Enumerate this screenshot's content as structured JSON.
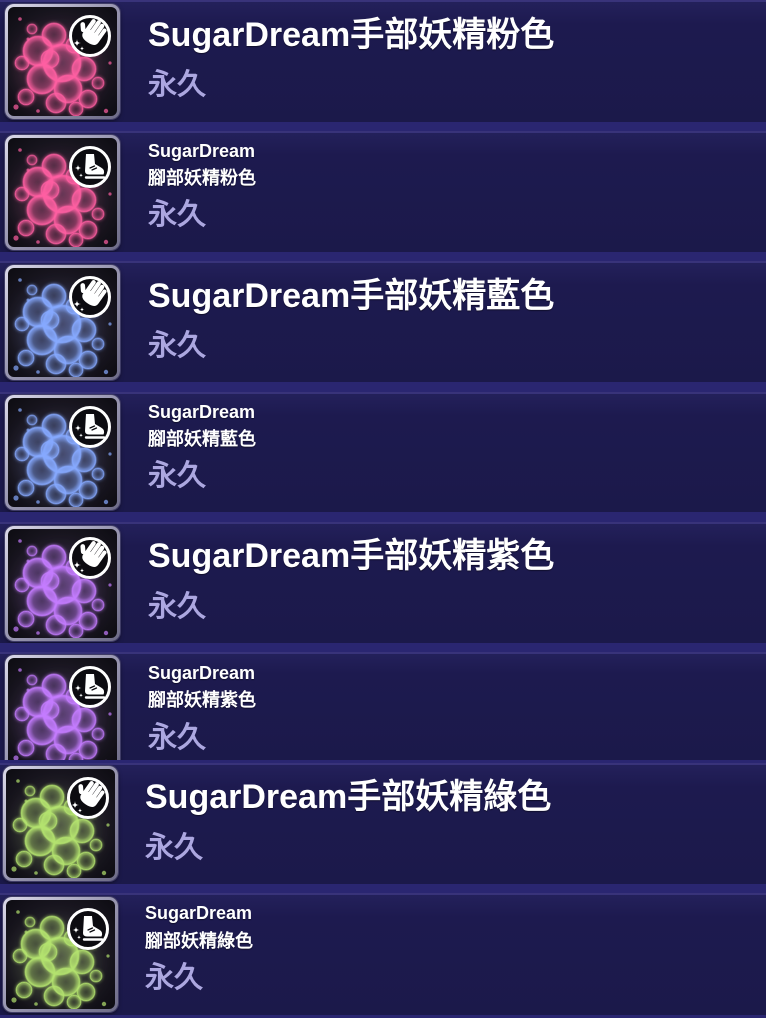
{
  "theme": {
    "row_background": "#1d1a4f",
    "separator": "#2a2671",
    "title_color": "#ffffff",
    "duration_color": "#aca7e0"
  },
  "items": [
    {
      "name": "SugarDream手部妖精粉色",
      "duration": "永久",
      "icon": "hand-icon",
      "bubble_color": "#ff5fa2"
    },
    {
      "name_line1": "SugarDream",
      "name_line2": "腳部妖精粉色",
      "duration": "永久",
      "icon": "foot-icon",
      "bubble_color": "#ff5fa2"
    },
    {
      "name": "SugarDream手部妖精藍色",
      "duration": "永久",
      "icon": "hand-icon",
      "bubble_color": "#86a9ff"
    },
    {
      "name_line1": "SugarDream",
      "name_line2": "腳部妖精藍色",
      "duration": "永久",
      "icon": "foot-icon",
      "bubble_color": "#86a9ff"
    },
    {
      "name": "SugarDream手部妖精紫色",
      "duration": "永久",
      "icon": "hand-icon",
      "bubble_color": "#c47cff"
    },
    {
      "name_line1": "SugarDream",
      "name_line2": "腳部妖精紫色",
      "duration": "永久",
      "icon": "foot-icon",
      "bubble_color": "#c47cff"
    },
    {
      "name": "SugarDream手部妖精綠色",
      "duration": "永久",
      "icon": "hand-icon",
      "bubble_color": "#b4e36f"
    },
    {
      "name_line1": "SugarDream",
      "name_line2": "腳部妖精綠色",
      "duration": "永久",
      "icon": "foot-icon",
      "bubble_color": "#b4e36f"
    }
  ]
}
